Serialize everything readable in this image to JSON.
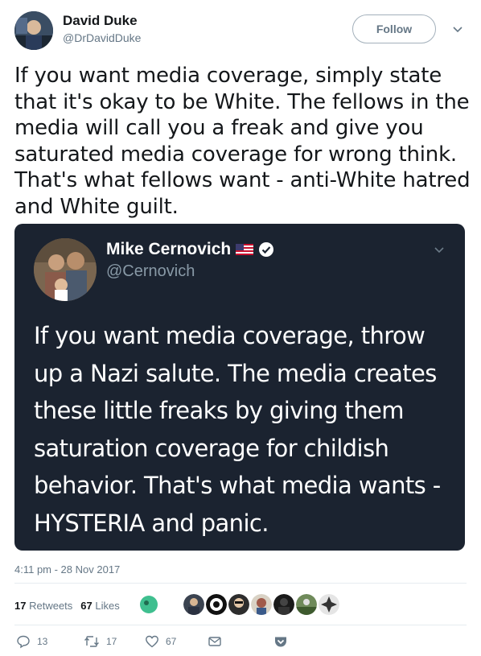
{
  "author": {
    "display_name": "David Duke",
    "handle": "@DrDavidDuke",
    "follow_label": "Follow"
  },
  "tweet": {
    "text": "If you want media coverage, simply state that it's okay to be White. The fellows in the media will call you a freak and give you saturated media coverage for wrong think. That's what fellows want - anti-White hatred and White guilt.",
    "timestamp": "4:11 pm - 28 Nov 2017"
  },
  "quoted": {
    "display_name": "Mike Cernovich",
    "handle": "@Cernovich",
    "text": "If you want media coverage, throw up a Nazi salute. The media creates these little freaks by giving them saturation coverage for childish behavior. That's what media wants - HYSTERIA and panic.",
    "flag_icon": "us-flag-icon",
    "verified_icon": "verified-badge-icon"
  },
  "stats": {
    "retweets_count": "17",
    "retweets_label": "Retweets",
    "likes_count": "67",
    "likes_label": "Likes"
  },
  "actions": {
    "reply_count": "13",
    "retweet_count": "17",
    "like_count": "67"
  },
  "colors": {
    "quote_bg": "#1b2330",
    "secondary_text": "#657786",
    "primary_text": "#14171a"
  }
}
